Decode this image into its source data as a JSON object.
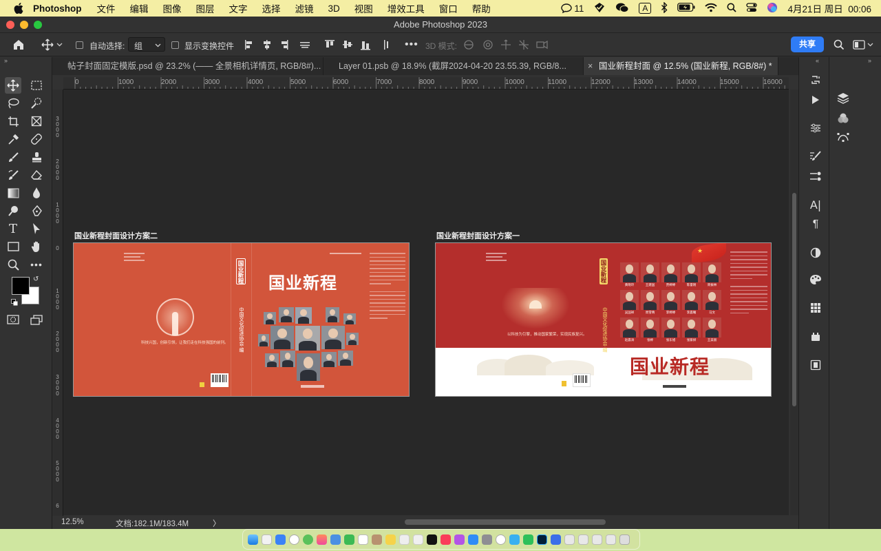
{
  "menubar": {
    "app_name": "Photoshop",
    "items": [
      "文件",
      "编辑",
      "图像",
      "图层",
      "文字",
      "选择",
      "滤镜",
      "3D",
      "视图",
      "增效工具",
      "窗口",
      "帮助"
    ],
    "notification_count": "11",
    "input_method": "A",
    "datetime": "4月21日 周日  00:06"
  },
  "window": {
    "title": "Adobe Photoshop 2023"
  },
  "options": {
    "auto_select_label": "自动选择:",
    "auto_select_value": "组",
    "show_transform_label": "显示变换控件",
    "mode_3d_label": "3D 模式:",
    "share_label": "共享"
  },
  "tabs": [
    {
      "label": "帖子封面固定模版.psd @ 23.2% (—— 全景相机详情页, RGB/8#)..."
    },
    {
      "label": "Layer 01.psb @ 18.9% (截屏2024-04-20 23.55.39, RGB/8..."
    },
    {
      "label": "国业新程封面 @ 12.5% (国业新程, RGB/8#) *"
    }
  ],
  "ruler_h": [
    "0",
    "1000",
    "2000",
    "3000",
    "4000",
    "5000",
    "6000",
    "7000",
    "8000",
    "9000",
    "10000",
    "11000",
    "12000",
    "13000",
    "14000",
    "15000",
    "16000"
  ],
  "ruler_v": [
    "3000",
    "2000",
    "1000",
    "0",
    "1000",
    "2000",
    "3000",
    "4000",
    "5000",
    "6"
  ],
  "status": {
    "zoom": "12.5%",
    "doc_info": "文档:182.1M/183.4M",
    "arrow": "〉"
  },
  "artboards": [
    {
      "label": "国业新程封面设计方案二",
      "title": "国业新程",
      "spine_title": "国业新程",
      "spine_org": "中国文化促进协会·编",
      "slogan": "科技兴国，创新引领，让我们走在科技强国的前列。",
      "colors": {
        "background": "#d2553b"
      }
    },
    {
      "label": "国业新程封面设计方案一",
      "title": "国业新程",
      "spine_title": "国业新程",
      "spine_org": "中国文化促进协会·编",
      "slogan": "以科技为引擎，推动国家繁荣，实现民族复兴。",
      "portrait_names": [
        "黄晓玲",
        "王建国",
        "贾婷婷",
        "陈雷刚",
        "周振林",
        "吴国祥",
        "周雪晴",
        "李婷婷",
        "李晨曦",
        "马文",
        "赵晨涛",
        "张婷",
        "张东旭",
        "张紫妍",
        "王美丽"
      ],
      "colors": {
        "top": "#b42e2c",
        "bottom": "#ffffff",
        "title": "#b82a25"
      }
    }
  ],
  "colors": {
    "menubar_bg": "#f4eea4",
    "desktop_bg": "#cfe6a0",
    "panel_bg": "#323232",
    "canvas_bg": "#282828",
    "accent": "#2f7cf6"
  }
}
